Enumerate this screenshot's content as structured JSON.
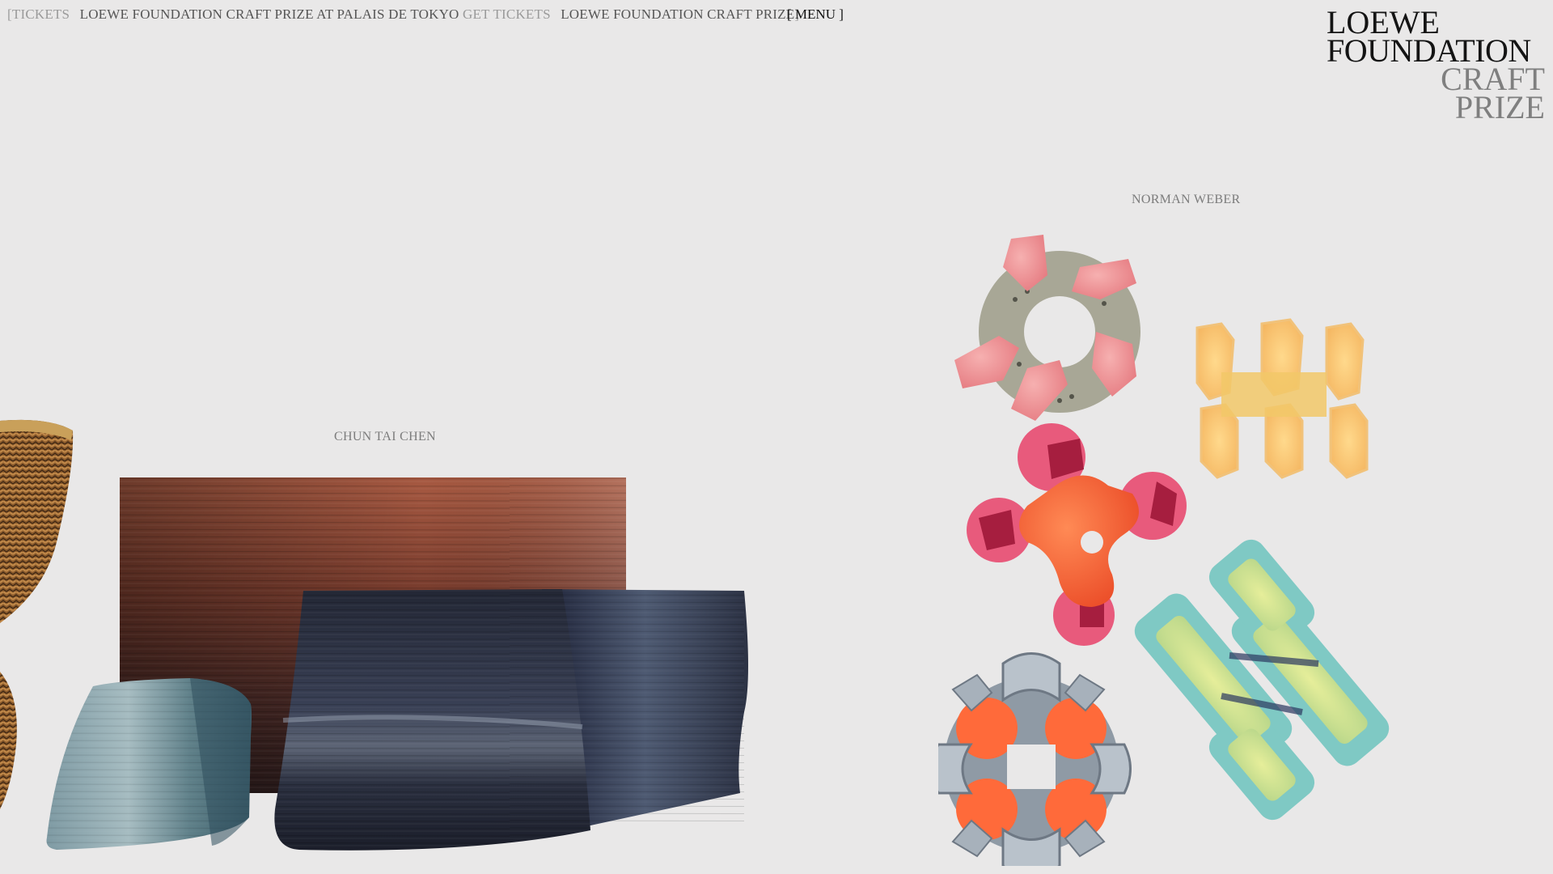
{
  "header": {
    "ticker": {
      "open_bracket": "[",
      "item1": "TICKETS",
      "item2": "LOEWE FOUNDATION CRAFT PRIZE AT PALAIS DE TOKYO",
      "item3": "GET TICKETS",
      "item4": "LOEWE FOUNDATION CRAFT PRIZE",
      "close_bracket": "]"
    },
    "menu_label": "[ MENU ]"
  },
  "logo": {
    "line1": "LOEWE",
    "line2": "FOUNDATION",
    "line3": "CRAFT",
    "line4": "PRIZE"
  },
  "artists": {
    "chun_tai_chen": "CHUN TAI CHEN",
    "norman_weber": "NORMAN WEBER"
  },
  "colors": {
    "background": "#e9e8e8",
    "logo_dark": "#141414",
    "logo_light": "#7f7f7f"
  }
}
